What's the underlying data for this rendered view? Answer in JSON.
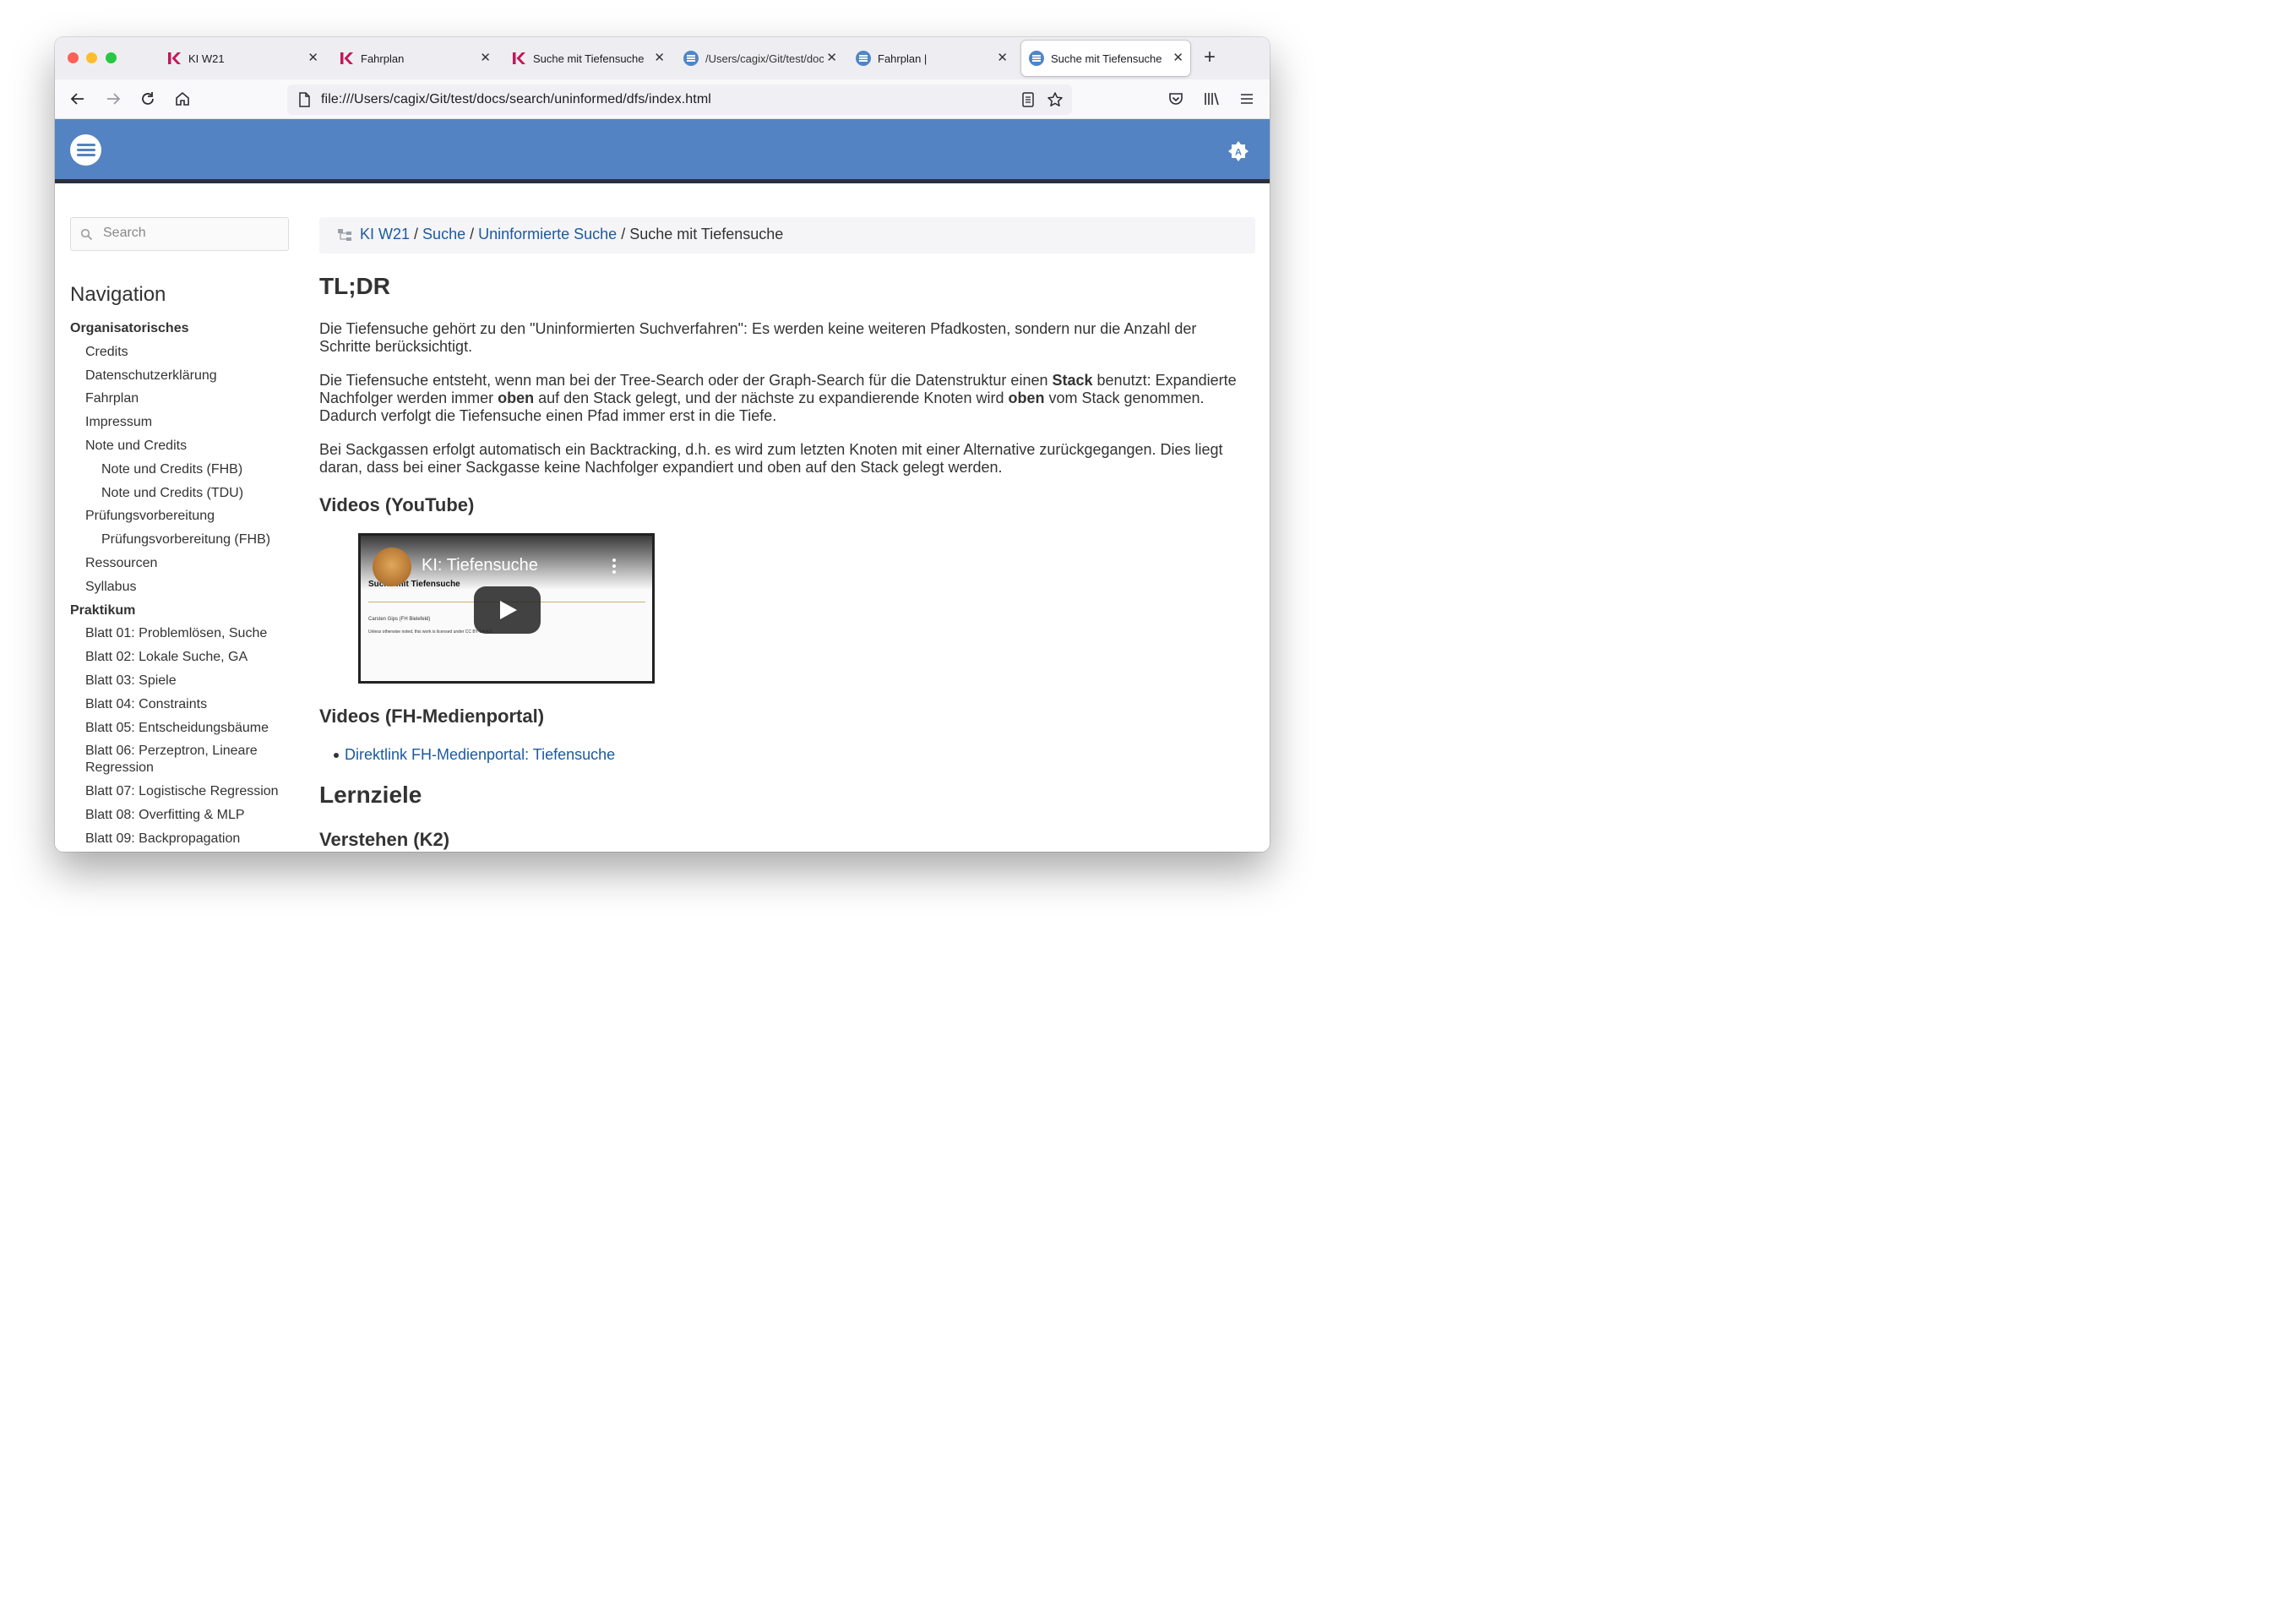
{
  "browser": {
    "tabs": [
      {
        "label": "KI W21",
        "favicon": "k-logo-icon",
        "active": false
      },
      {
        "label": "Fahrplan",
        "favicon": "k-logo-icon",
        "active": false
      },
      {
        "label": "Suche mit Tiefensuche",
        "favicon": "k-logo-icon",
        "active": false
      },
      {
        "label": "/Users/cagix/Git/test/docs",
        "favicon": "doc-icon",
        "active": false
      },
      {
        "label": "Fahrplan |",
        "favicon": "doc-icon",
        "active": false
      },
      {
        "label": "Suche mit Tiefensuche",
        "favicon": "doc-icon",
        "active": true
      }
    ],
    "url": "file:///Users/cagix/Git/test/docs/search/uninformed/dfs/index.html",
    "accent": "#5383c2"
  },
  "sidebar": {
    "search_placeholder": "Search",
    "nav_title": "Navigation",
    "items": [
      {
        "label": "Organisatorisches",
        "level": 0
      },
      {
        "label": "Credits",
        "level": 1
      },
      {
        "label": "Datenschutzerklärung",
        "level": 1
      },
      {
        "label": "Fahrplan",
        "level": 1
      },
      {
        "label": "Impressum",
        "level": 1
      },
      {
        "label": "Note und Credits",
        "level": 1
      },
      {
        "label": "Note und Credits (FHB)",
        "level": 2
      },
      {
        "label": "Note und Credits (TDU)",
        "level": 2
      },
      {
        "label": "Prüfungsvorbereitung",
        "level": 1
      },
      {
        "label": "Prüfungsvorbereitung (FHB)",
        "level": 2
      },
      {
        "label": "Ressourcen",
        "level": 1
      },
      {
        "label": "Syllabus",
        "level": 1
      },
      {
        "label": "Praktikum",
        "level": 0
      },
      {
        "label": "Blatt 01: Problemlösen, Suche",
        "level": 1
      },
      {
        "label": "Blatt 02: Lokale Suche, GA",
        "level": 1
      },
      {
        "label": "Blatt 03: Spiele",
        "level": 1
      },
      {
        "label": "Blatt 04: Constraints",
        "level": 1
      },
      {
        "label": "Blatt 05: Entscheidungsbäume",
        "level": 1
      },
      {
        "label": "Blatt 06: Perzeptron, Lineare Regression",
        "level": 1
      },
      {
        "label": "Blatt 07: Logistische Regression",
        "level": 1
      },
      {
        "label": "Blatt 08: Overfitting & MLP",
        "level": 1
      },
      {
        "label": "Blatt 09: Backpropagation",
        "level": 1
      }
    ]
  },
  "breadcrumb": {
    "links": [
      "KI W21",
      "Suche",
      "Uninformierte Suche"
    ],
    "current": "Suche mit Tiefensuche"
  },
  "content": {
    "h_tldr": "TL;DR",
    "p1": "Die Tiefensuche gehört zu den \"Uninformierten Suchverfahren\": Es werden keine weiteren Pfadkosten, sondern nur die Anzahl der Schritte berücksichtigt.",
    "p2_a": "Die Tiefensuche entsteht, wenn man bei der Tree-Search oder der Graph-Search für die Datenstruktur einen ",
    "p2_b": "Stack",
    "p2_c": " benutzt: Expandierte Nachfolger werden immer ",
    "p2_d": "oben",
    "p2_e": " auf den Stack gelegt, und der nächste zu expandierende Knoten wird ",
    "p2_f": "oben",
    "p2_g": " vom Stack genommen. Dadurch verfolgt die Tiefensuche einen Pfad immer erst in die Tiefe.",
    "p3": "Bei Sackgassen erfolgt automatisch ein Backtracking, d.h. es wird zum letzten Knoten mit einer Alternative zurückgegangen. Dies liegt daran, dass bei einer Sackgasse keine Nachfolger expandiert und oben auf den Stack gelegt werden.",
    "h_youtube": "Videos (YouTube)",
    "video": {
      "title": "KI: Tiefensuche",
      "slide_title": "Suche mit Tiefensuche",
      "author": "Carsten Gips (FH Bielefeld)",
      "license": "Unless otherwise noted, this work is licensed under CC BY-SA 4.0."
    },
    "h_medienportal": "Videos (FH-Medienportal)",
    "medienportal_link": "Direktlink FH-Medienportal: Tiefensuche",
    "h_lernziele": "Lernziele",
    "h_verstehen": "Verstehen (K2)"
  }
}
